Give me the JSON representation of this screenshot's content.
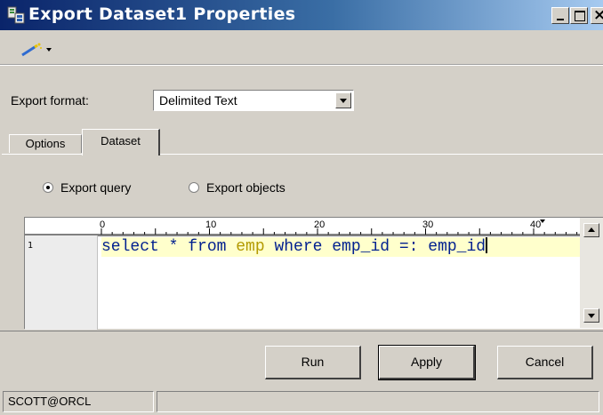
{
  "window": {
    "title": "Export Dataset1 Properties",
    "icon": "dataset-export-icon"
  },
  "toolbar": {
    "tool_icon": "magic-wand-icon"
  },
  "export": {
    "format_label": "Export format:",
    "format_value": "Delimited Text"
  },
  "tabs": [
    {
      "label": "Options",
      "active": false
    },
    {
      "label": "Dataset",
      "active": true
    }
  ],
  "radios": {
    "query_label": "Export query",
    "objects_label": "Export objects",
    "selected": "query"
  },
  "editor": {
    "ruler_labels": [
      "0",
      "10",
      "20",
      "30",
      "40"
    ],
    "line_number": "1",
    "code": {
      "part1": "select * from ",
      "table": "emp",
      "part2": " where emp_id =: emp_id"
    }
  },
  "buttons": {
    "run": "Run",
    "apply": "Apply",
    "cancel": "Cancel"
  },
  "status": {
    "connection": "SCOTT@ORCL"
  },
  "colors": {
    "titlebar_start": "#0a246a",
    "titlebar_end": "#a6caf0",
    "keyword": "#001f8f",
    "table_name": "#b39a00",
    "current_line": "#ffffcc"
  }
}
